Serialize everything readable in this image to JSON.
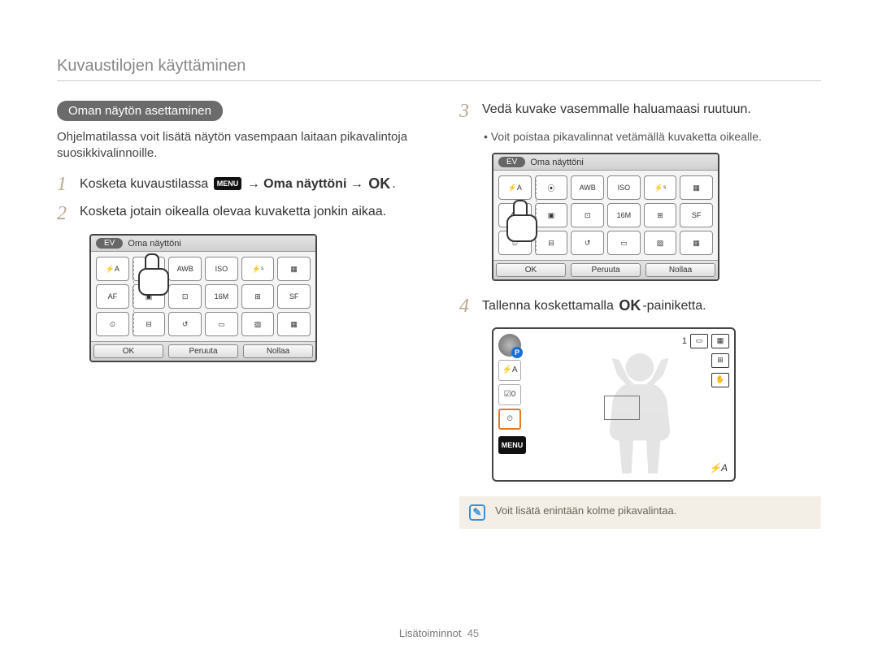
{
  "breadcrumb": "Kuvaustilojen käyttäminen",
  "section_heading": "Oman näytön asettaminen",
  "intro_text": "Ohjelmatilassa voit lisätä näytön vasempaan laitaan pikavalintoja suosikkivalinnoille.",
  "steps": {
    "s1_pre": "Kosketa kuvaustilassa ",
    "s1_menu_icon": "MENU",
    "s1_arrow": "→",
    "s1_bold": "Oma näyttöni",
    "s1_post": ".",
    "ok_glyph": "OK",
    "s2": "Kosketa jotain oikealla olevaa kuvaketta jonkin aikaa.",
    "s3": "Vedä kuvake vasemmalle haluamaasi ruutuun.",
    "s3_sub": "Voit poistaa pikavalinnat vetämällä kuvaketta oikealle.",
    "s4_pre": "Tallenna koskettamalla ",
    "s4_post": "-painiketta."
  },
  "screen": {
    "ev_label": "EV",
    "title": "Oma näyttöni",
    "buttons": {
      "ok": "OK",
      "cancel": "Peruuta",
      "reset": "Nollaa"
    },
    "icons": [
      "⚡A",
      "⦿",
      "AWB",
      "ISO",
      "⚡ˢ",
      "▦",
      "AF",
      "▣",
      "⊡",
      "16M",
      "⊞",
      "SF",
      "⏲",
      "⊟",
      "↺",
      "▭",
      "▨",
      "▦"
    ]
  },
  "liveview": {
    "mode": "P",
    "slots": [
      "⚡A",
      "☑0",
      "⏲"
    ],
    "menu": "MENU",
    "count": "1",
    "right_icons": [
      "▭",
      "▦",
      "⊞",
      "✋"
    ],
    "br": "⚡A"
  },
  "note": {
    "icon": "✎",
    "text": "Voit lisätä enintään kolme pikavalintaa."
  },
  "footer": {
    "label": "Lisätoiminnot",
    "page": "45"
  }
}
